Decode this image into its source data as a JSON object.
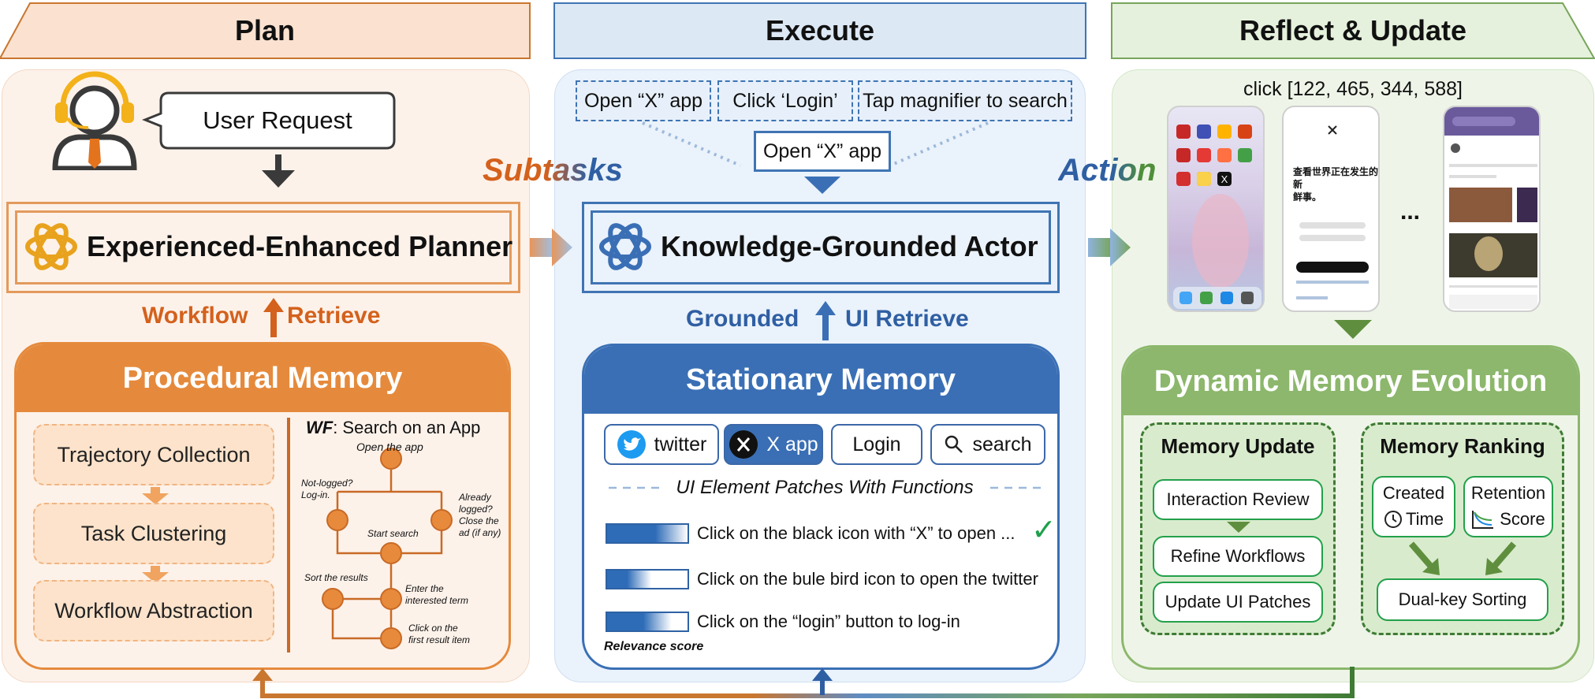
{
  "headers": {
    "plan": "Plan",
    "execute": "Execute",
    "reflect": "Reflect & Update"
  },
  "plan": {
    "user_request": "User Request",
    "planner": "Experienced-Enhanced Planner",
    "workflow_label": "Workflow",
    "retrieve_label": "Retrieve",
    "procedural_memory": "Procedural Memory",
    "steps": [
      "Trajectory Collection",
      "Task Clustering",
      "Workflow Abstraction"
    ],
    "wf_prefix": "WF",
    "wf_title": ":  Search on an App",
    "wf_nodes": {
      "open": "Open the app",
      "not_logged_1": "Not-logged?",
      "not_logged_2": "Log-in.",
      "already_1": "Already",
      "already_2": "logged?",
      "already_3": "Close the",
      "already_4": "ad (if any)",
      "start_search": "Start search",
      "sort": "Sort the results",
      "enter_1": "Enter the",
      "enter_2": "interested term",
      "click_1": "Click on the",
      "click_2": "first result item"
    }
  },
  "subtasks_label": "Subtasks",
  "execute": {
    "subtasks": [
      "Open “X” app",
      "Click ‘Login’",
      "Tap magnifier to search"
    ],
    "current_subtask": "Open “X” app",
    "actor": "Knowledge-Grounded Actor",
    "grounded_label": "Grounded",
    "ui_retrieve_label": "UI Retrieve",
    "stationary_memory": "Stationary Memory",
    "chips": [
      "twitter",
      "X app",
      "Login",
      "search"
    ],
    "patches_caption": "UI Element Patches With Functions",
    "patches": [
      "Click on the black icon with “X” to open ...",
      "Click on the bule bird icon to open the twitter",
      "Click on the “login” button to log-in"
    ],
    "relevance_label": "Relevance score",
    "check_mark": "✓"
  },
  "action_label": "Action",
  "reflect": {
    "click_text": "click [122, 465, 344, 588]",
    "ellipsis": "...",
    "dynamic_memory": "Dynamic Memory Evolution",
    "memory_update": "Memory Update",
    "update_items": [
      "Interaction Review",
      "Refine Workflows",
      "Update UI Patches"
    ],
    "memory_ranking": "Memory Ranking",
    "created_1": "Created",
    "created_2": "Time",
    "retention_1": "Retention",
    "retention_2": "Score",
    "dual_key": "Dual-key Sorting",
    "phone2_text_1": "查看世界正在发生的新",
    "phone2_text_2": "鲜事。"
  },
  "colors": {
    "plan_header": "#fbe2d0",
    "plan_border": "#c9762f",
    "plan_panel": "#fdf2ea",
    "orange": "#e58a3c",
    "orange_text": "#d4611c",
    "execute_header": "#dde8f5",
    "execute_border": "#3f74b3",
    "execute_panel": "#eaf2fb",
    "blue": "#3a6fb5",
    "blue_text": "#2f5fa3",
    "reflect_header": "#e5f1dc",
    "reflect_border": "#77a55a",
    "reflect_panel": "#eef5e8",
    "green": "#8cb76c",
    "green_text": "#3f7b35"
  }
}
